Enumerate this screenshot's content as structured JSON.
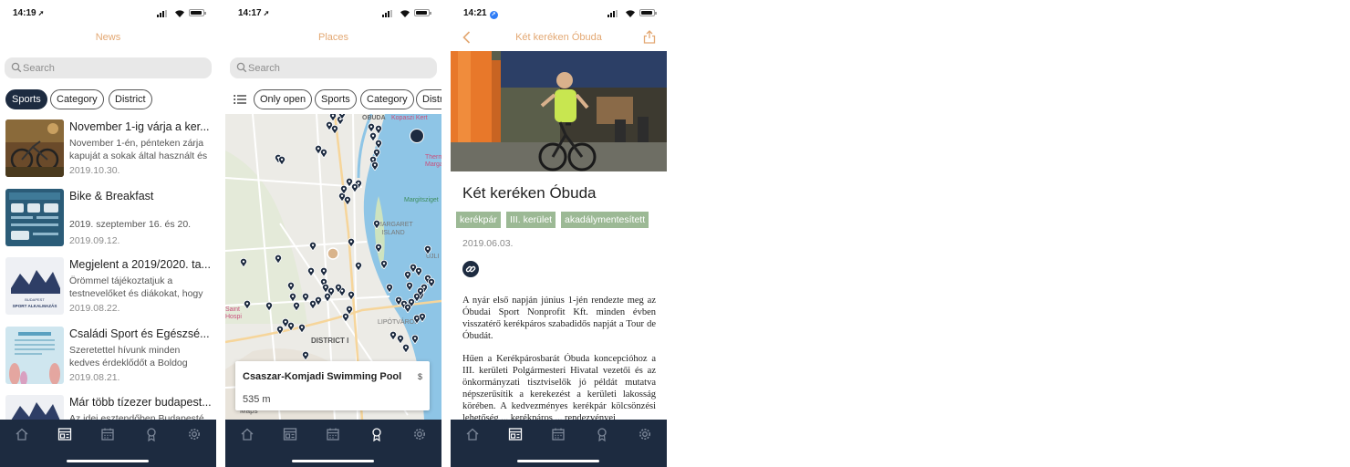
{
  "screens": [
    {
      "status_time": "14:19",
      "title": "News",
      "search_placeholder": "Search",
      "filters": [
        "Sports",
        "Category",
        "District"
      ],
      "items": [
        {
          "title": "November 1-ig várja a ker...",
          "excerpt": "November 1-én, pénteken zárja kapuját a sokak által használt és",
          "date": "2019.10.30."
        },
        {
          "title": "Bike & Breakfast",
          "excerpt": "2019. szeptember 16. és 20.",
          "date": "2019.09.12."
        },
        {
          "title": "Megjelent a 2019/2020. ta...",
          "excerpt": "Örömmel tájékoztatjuk a testnevelőket és diákokat, hogy",
          "date": "2019.08.22."
        },
        {
          "title": "Családi Sport és Egészsé...",
          "excerpt": "Szeretettel hívunk minden kedves érdeklődőt a Boldog",
          "date": "2019.08.21."
        },
        {
          "title": "Már több tízezer budapest...",
          "excerpt": "Az idei esztendőben Budapesté",
          "date": ""
        }
      ],
      "thumb_labels": {
        "sport_alkalmazas": "BUDAPEST SPORT ALKALMAZÁS"
      }
    },
    {
      "status_time": "14:17",
      "title": "Places",
      "search_placeholder": "Search",
      "filters": [
        "Only open",
        "Sports",
        "Category",
        "Distr"
      ],
      "map_labels": {
        "obuda": "ÓBUDA",
        "kopaszi": "Kopaszi Kert",
        "thermal": "Therm Marga",
        "margitsziget": "Margitsziget",
        "margaret_island": "MARGARET ISLAND",
        "ujlipot": "ÚJLI",
        "lipotvaros": "LIPÓTVÁROS",
        "district": "DISTRICT I",
        "hospital": "Saint Hospi",
        "maps": "Maps"
      },
      "card": {
        "name": "Csaszar-Komjadi Swimming Pool",
        "price": "$",
        "distance": "535 m"
      }
    },
    {
      "status_time": "14:21",
      "title": "Két keréken Óbuda",
      "article_title": "Két keréken Óbuda",
      "tags": [
        "kerékpár",
        "III. kerület",
        "akadálymentesített"
      ],
      "date": "2019.06.03.",
      "paragraphs": [
        "A nyár első napján június 1-jén rendezte meg az Óbudai Sport Nonprofit Kft. minden évben visszatérő kerékpáros szabadidős napját a Tour de Óbudát.",
        "Hűen a Kerékpárosbarát Óbuda koncepcióhoz a III. kerületi Polgármesteri Hivatal vezetői és az önkormányzati tisztviselők jó példát mutatva népszerűsítik a kerekezést a kerületi lakosság körében. A kedvezményes kerékpár kölcsönzési lehetőség ... kerékpáros ... rendezvényei"
      ]
    }
  ],
  "tabbar": {
    "icons": [
      "home-icon",
      "news-icon",
      "calendar-icon",
      "places-icon",
      "settings-icon"
    ],
    "active": [
      1,
      3,
      1
    ],
    "bg": "#1d2b40"
  },
  "colors": {
    "accent": "#e3a873",
    "navy": "#1d2b40",
    "tag": "#9cb995"
  }
}
